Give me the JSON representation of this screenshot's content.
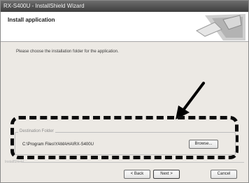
{
  "window": {
    "title": "RX-S400U - InstallShield Wizard"
  },
  "header": {
    "title": "Install application"
  },
  "main": {
    "instruction": "Please choose the installation folder for the application."
  },
  "destination": {
    "group_label": "Destination Folder",
    "path": "C:\\Program Files\\YAMAHA\\RX-S400U",
    "browse_label": "Browse..."
  },
  "footer": {
    "label": "InstallShield",
    "back_label": "< Back",
    "next_label": "Next >",
    "cancel_label": "Cancel"
  }
}
